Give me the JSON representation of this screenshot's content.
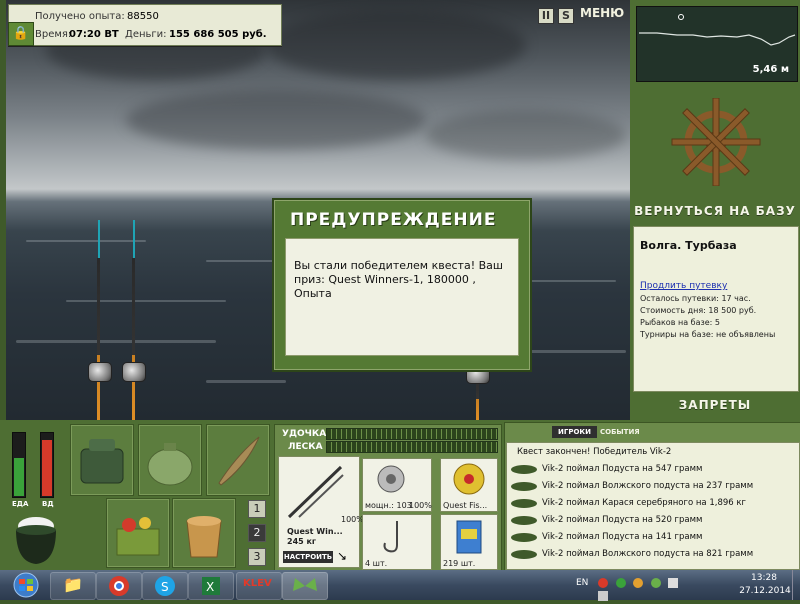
{
  "info": {
    "experience_label": "Получено опыта:",
    "experience_value": "88550",
    "time_label": "Время:",
    "time_value": "07:20 ВТ",
    "money_label": "Деньги:",
    "money_value": "155 686 505 руб."
  },
  "top_menu": {
    "pause_label": "II",
    "s_label": "S",
    "menu_label": "МЕНЮ"
  },
  "depth": {
    "value": "5,46 м"
  },
  "base": {
    "return_label": "ВЕРНУТЬСЯ НА БАЗУ",
    "location": "Волга. Турбаза",
    "extend_link": "Продлить путевку",
    "lines": [
      "Осталось путевки: 17 час.",
      "Стоимость дня: 18 500 руб.",
      "Рыбаков на базе: 5",
      "Турниры на базе: не объявлены"
    ],
    "bans_label": "ЗАПРЕТЫ"
  },
  "dialog": {
    "title": "ПРЕДУПРЕЖДЕНИЕ",
    "message": "Вы стали победителем квеста! Ваш приз: Quest Winners-1, 180000 , Опыта"
  },
  "needs": {
    "food_label": "ЕДА",
    "thirst_label": "ВД",
    "food_level": 0.62,
    "thirst_level": 0.9
  },
  "slot_numbers": [
    "1",
    "2",
    "3"
  ],
  "rod_panel": {
    "rod_label": "УДОЧКА",
    "line_label": "ЛЕСКА",
    "rod_name": "Quest Win...",
    "rod_weight": "245 кг",
    "rod_percent": "100%",
    "reel_info": "мощн.: 103",
    "reel_percent": "100%",
    "line_name": "Quest Fis...",
    "hooks_count": "4 шт.",
    "bait_count": "219 шт.",
    "tune_label": "НАСТРОИТЬ"
  },
  "events": {
    "tab_players": "ИГРОКИ",
    "tab_events": "СОБЫТИЯ",
    "quest_done": "Квест закончен! Победитель Vik-2",
    "items": [
      "Vik-2 поймал Подуста на 547 грамм",
      "Vik-2 поймал Волжского подуста на 237 грамм",
      "Vik-2 поймал Карася серебряного на 1,896 кг",
      "Vik-2 поймал Подуста на 520 грамм",
      "Vik-2 поймал Подуста на 141 грамм",
      "Vik-2 поймал Волжского подуста на 821 грамм"
    ]
  },
  "taskbar": {
    "lang": "EN",
    "time": "13:28",
    "date": "27.12.2014",
    "app_label": "KLEV"
  }
}
